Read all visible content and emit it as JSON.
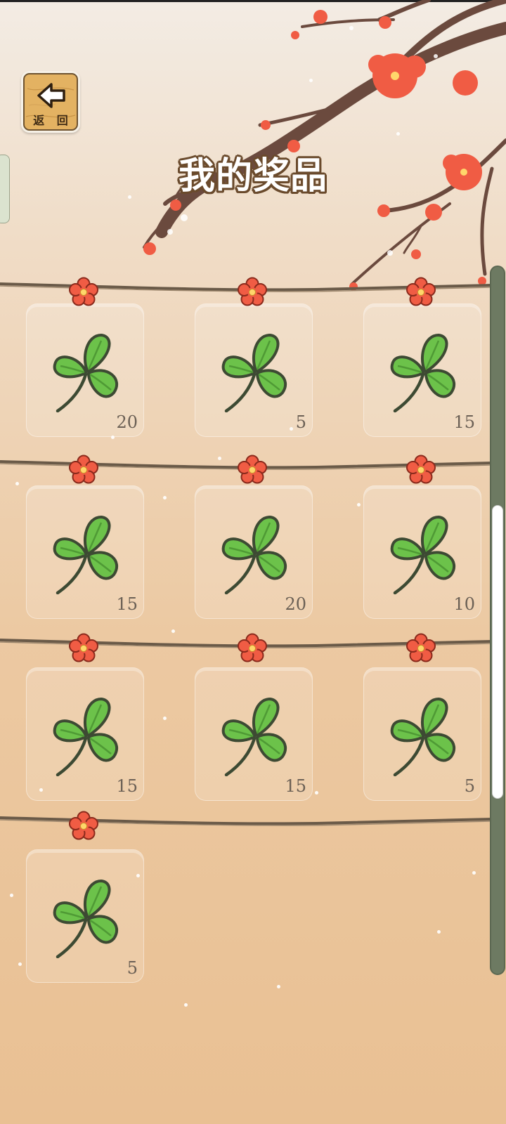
{
  "header": {
    "title": "我的奖品",
    "back_label": "返 回"
  },
  "prizes": [
    {
      "name": "clover",
      "quantity": "20"
    },
    {
      "name": "clover",
      "quantity": "5"
    },
    {
      "name": "clover",
      "quantity": "15"
    },
    {
      "name": "clover",
      "quantity": "15"
    },
    {
      "name": "clover",
      "quantity": "20"
    },
    {
      "name": "clover",
      "quantity": "10"
    },
    {
      "name": "clover",
      "quantity": "15"
    },
    {
      "name": "clover",
      "quantity": "15"
    },
    {
      "name": "clover",
      "quantity": "5"
    },
    {
      "name": "clover",
      "quantity": "5"
    }
  ],
  "icons": {
    "back": "arrow-left-icon",
    "item": "clover-icon",
    "pin": "flower-pin-icon"
  },
  "scroll": {
    "position_fraction": 0.58,
    "visible_fraction": 0.42
  },
  "colors": {
    "background_top": "#f3ece4",
    "background_bottom": "#e9c093",
    "blossom": "#f05c44",
    "branch": "#6b4a3e",
    "clover": "#6cc24a",
    "clover_outline": "#3d4a33",
    "title_outline": "#6a4a2c",
    "wood": "#e3b262",
    "scrollbar": "#6d7a62"
  }
}
